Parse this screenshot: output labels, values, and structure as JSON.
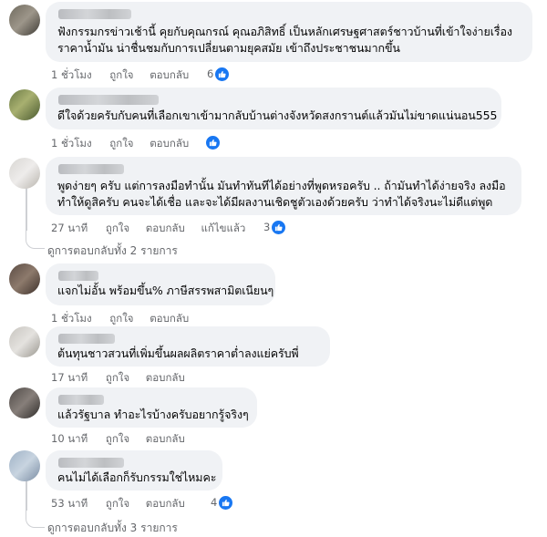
{
  "comments": [
    {
      "lines": [
        "ฟังกรรมกรข่าวเช้านี้ คุยกับคุณกรณ์ คุณอภิสิทธิ์ เป็นหลักเศรษฐศาสตร์ชาวบ้านที่เข้าใจง่ายเรื่อง",
        "ราคาน้ำมัน น่าชื่นชมกับการเปลี่ยนตามยุคสมัย เข้าถึงประชาชนมากขึ้น"
      ],
      "time": "1 ชั่วโมง",
      "like_label": "ถูกใจ",
      "reply_label": "ตอบกลับ",
      "reactions": "6"
    },
    {
      "lines": [
        "ดีใจด้วยครับกับคนที่เลือกเขาเข้ามากลับบ้านต่างจังหวัดสงกรานต์แล้วมันไม่ขาดแน่นอน555"
      ],
      "time": "1 ชั่วโมง",
      "like_label": "ถูกใจ",
      "reply_label": "ตอบกลับ",
      "reactions": ""
    },
    {
      "lines": [
        "พูดง่ายๆ ครับ แต่การลงมือทำนั้น มันทำทันทีได้อย่างที่พูดหรอครับ .. ถ้ามันทำได้ง่ายจริง ลงมือ",
        "ทำให้ดูสิครับ คนจะได้เชื่อ และจะได้มีผลงานเชิดชูตัวเองด้วยครับ ว่าทำได้จริงนะไม่ดีแต่พูด"
      ],
      "time": "27 นาที",
      "like_label": "ถูกใจ",
      "reply_label": "ตอบกลับ",
      "edited_label": "แก้ไขแล้ว",
      "reactions": "3"
    },
    {
      "lines": [
        "แจกไม่อั้น พร้อมขึ้น% ภาษีสรรพสามิตเนียนๆ"
      ],
      "time": "1 ชั่วโมง",
      "like_label": "ถูกใจ",
      "reply_label": "ตอบกลับ",
      "reactions": ""
    },
    {
      "lines": [
        "ต้นทุนชาวสวนที่เพิ่มขึ้นผลผลิตราคาต่ำลงแย่ครับพี่"
      ],
      "time": "17 นาที",
      "like_label": "ถูกใจ",
      "reply_label": "ตอบกลับ",
      "reactions": ""
    },
    {
      "lines": [
        "แล้วรัฐบาล ทำอะไรบ้างครับอยากรู้จริงๆ"
      ],
      "time": "10 นาที",
      "like_label": "ถูกใจ",
      "reply_label": "ตอบกลับ",
      "reactions": ""
    },
    {
      "lines": [
        "คนไม่ได้เลือกก็รับกรรมใช่ไหมคะ"
      ],
      "time": "53 นาที",
      "like_label": "ถูกใจ",
      "reply_label": "ตอบกลับ",
      "reactions": "4"
    }
  ],
  "view_more_1": "ดูการตอบกลับทั้ง 2 รายการ",
  "view_more_2": "ดูการตอบกลับทั้ง 3 รายการ",
  "colors": {
    "like_blue": "#1877f2",
    "bubble": "#f0f2f5",
    "meta": "#65676b"
  },
  "icons": {
    "reaction": "like-thumb-icon"
  }
}
